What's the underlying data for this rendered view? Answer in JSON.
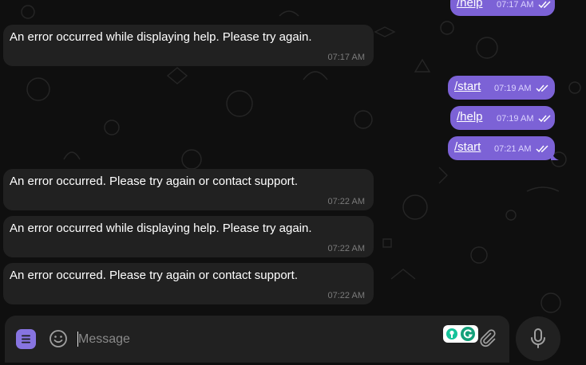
{
  "messages": [
    {
      "kind": "outgoing",
      "text": "/help",
      "time": "07:17 AM"
    },
    {
      "kind": "incoming",
      "text": "An error occurred while displaying help. Please try again.",
      "time": "07:17 AM"
    },
    {
      "kind": "outgoing",
      "text": "/start",
      "time": "07:19 AM"
    },
    {
      "kind": "outgoing",
      "text": "/help",
      "time": "07:19 AM"
    },
    {
      "kind": "outgoing",
      "text": "/start",
      "time": "07:21 AM"
    },
    {
      "kind": "incoming",
      "text": "An error occurred. Please try again or contact support.",
      "time": "07:22 AM"
    },
    {
      "kind": "incoming",
      "text": "An error occurred while displaying help. Please try again.",
      "time": "07:22 AM"
    },
    {
      "kind": "incoming",
      "text": "An error occurred. Please try again or contact support.",
      "time": "07:22 AM"
    }
  ],
  "composer": {
    "placeholder": "Message",
    "value": ""
  },
  "icons": {
    "menu": "bot-menu-icon",
    "emoji": "smile-icon",
    "grammarly": "grammarly-icon",
    "attach": "paperclip-icon",
    "mic": "microphone-icon",
    "read_status": "double-check-icon"
  },
  "colors": {
    "background": "#0f0f0f",
    "incoming_bubble": "#212121",
    "outgoing_bubble": "#7c62d6",
    "accent": "#8774e1",
    "time_incoming": "#7b7b7b",
    "time_outgoing": "#dcd4ff"
  }
}
